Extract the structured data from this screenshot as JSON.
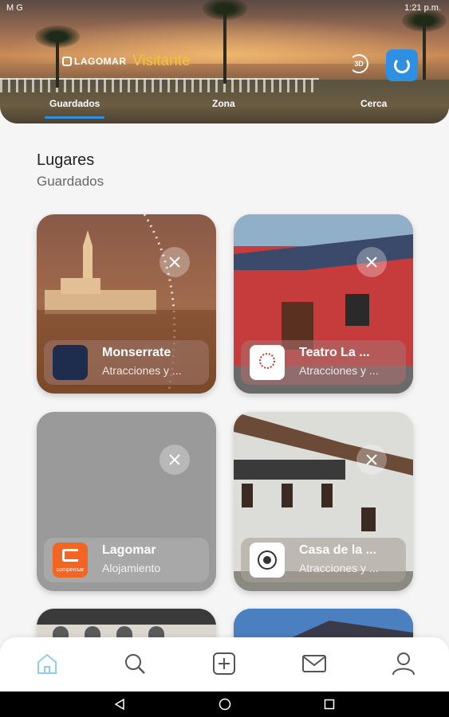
{
  "status_bar": {
    "left": "M G",
    "right": "1:21 p.m."
  },
  "header": {
    "logo": "LAGOMAR",
    "title": "Visitante",
    "icon_3d_label": "3D",
    "tabs": [
      {
        "label": "Guardados",
        "active": true
      },
      {
        "label": "Zona",
        "active": false
      },
      {
        "label": "Cerca",
        "active": false
      }
    ]
  },
  "section": {
    "title": "Lugares",
    "subtitle": "Guardados"
  },
  "cards": [
    {
      "name": "Monserrate",
      "category": "Atracciones y ..."
    },
    {
      "name": "Teatro La ...",
      "category": "Atracciones y ..."
    },
    {
      "name": "Lagomar",
      "category": "Alojamiento",
      "logo_text": "compensar"
    },
    {
      "name": "Casa de la ...",
      "category": "Atracciones y ..."
    }
  ],
  "bottom_nav": {
    "items": [
      "home-icon",
      "search-icon",
      "add-icon",
      "mail-icon",
      "profile-icon"
    ],
    "active": "home-icon"
  },
  "colors": {
    "accent": "#2f8fe0",
    "title_yellow": "#f6c23a",
    "compensar_orange": "#f26522"
  }
}
